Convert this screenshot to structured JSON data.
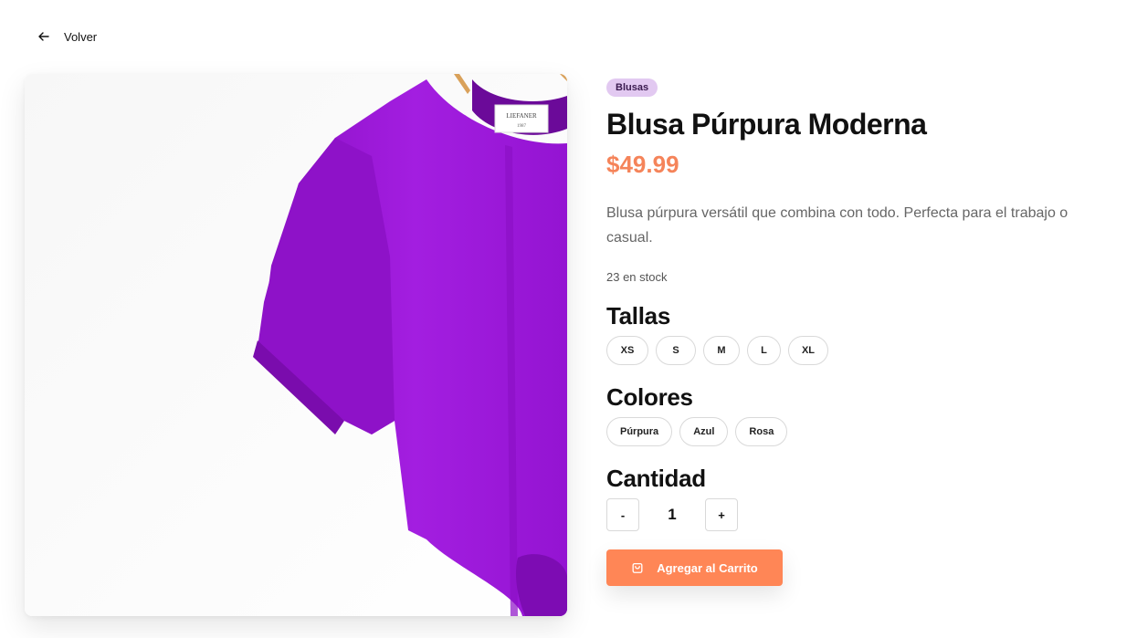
{
  "nav": {
    "back_label": "Volver"
  },
  "product": {
    "category": "Blusas",
    "title": "Blusa Púrpura Moderna",
    "price": "$49.99",
    "description": "Blusa púrpura versátil que combina con todo. Perfecta para el trabajo o casual.",
    "stock": "23 en stock",
    "image_alt": "purple blouse on hanger",
    "label_text": "LIEFANER",
    "label_sub": "1987"
  },
  "sizes": {
    "title": "Tallas",
    "options": [
      "XS",
      "S",
      "M",
      "L",
      "XL"
    ]
  },
  "colors": {
    "title": "Colores",
    "options": [
      "Púrpura",
      "Azul",
      "Rosa"
    ]
  },
  "quantity": {
    "title": "Cantidad",
    "minus": "-",
    "value": "1",
    "plus": "+"
  },
  "cart": {
    "label": "Agregar al Carrito"
  },
  "theme": {
    "accent": "#ff8656",
    "price_color": "#f5845a",
    "badge_bg": "#e2c9f1",
    "blouse": "#9a14d6"
  }
}
